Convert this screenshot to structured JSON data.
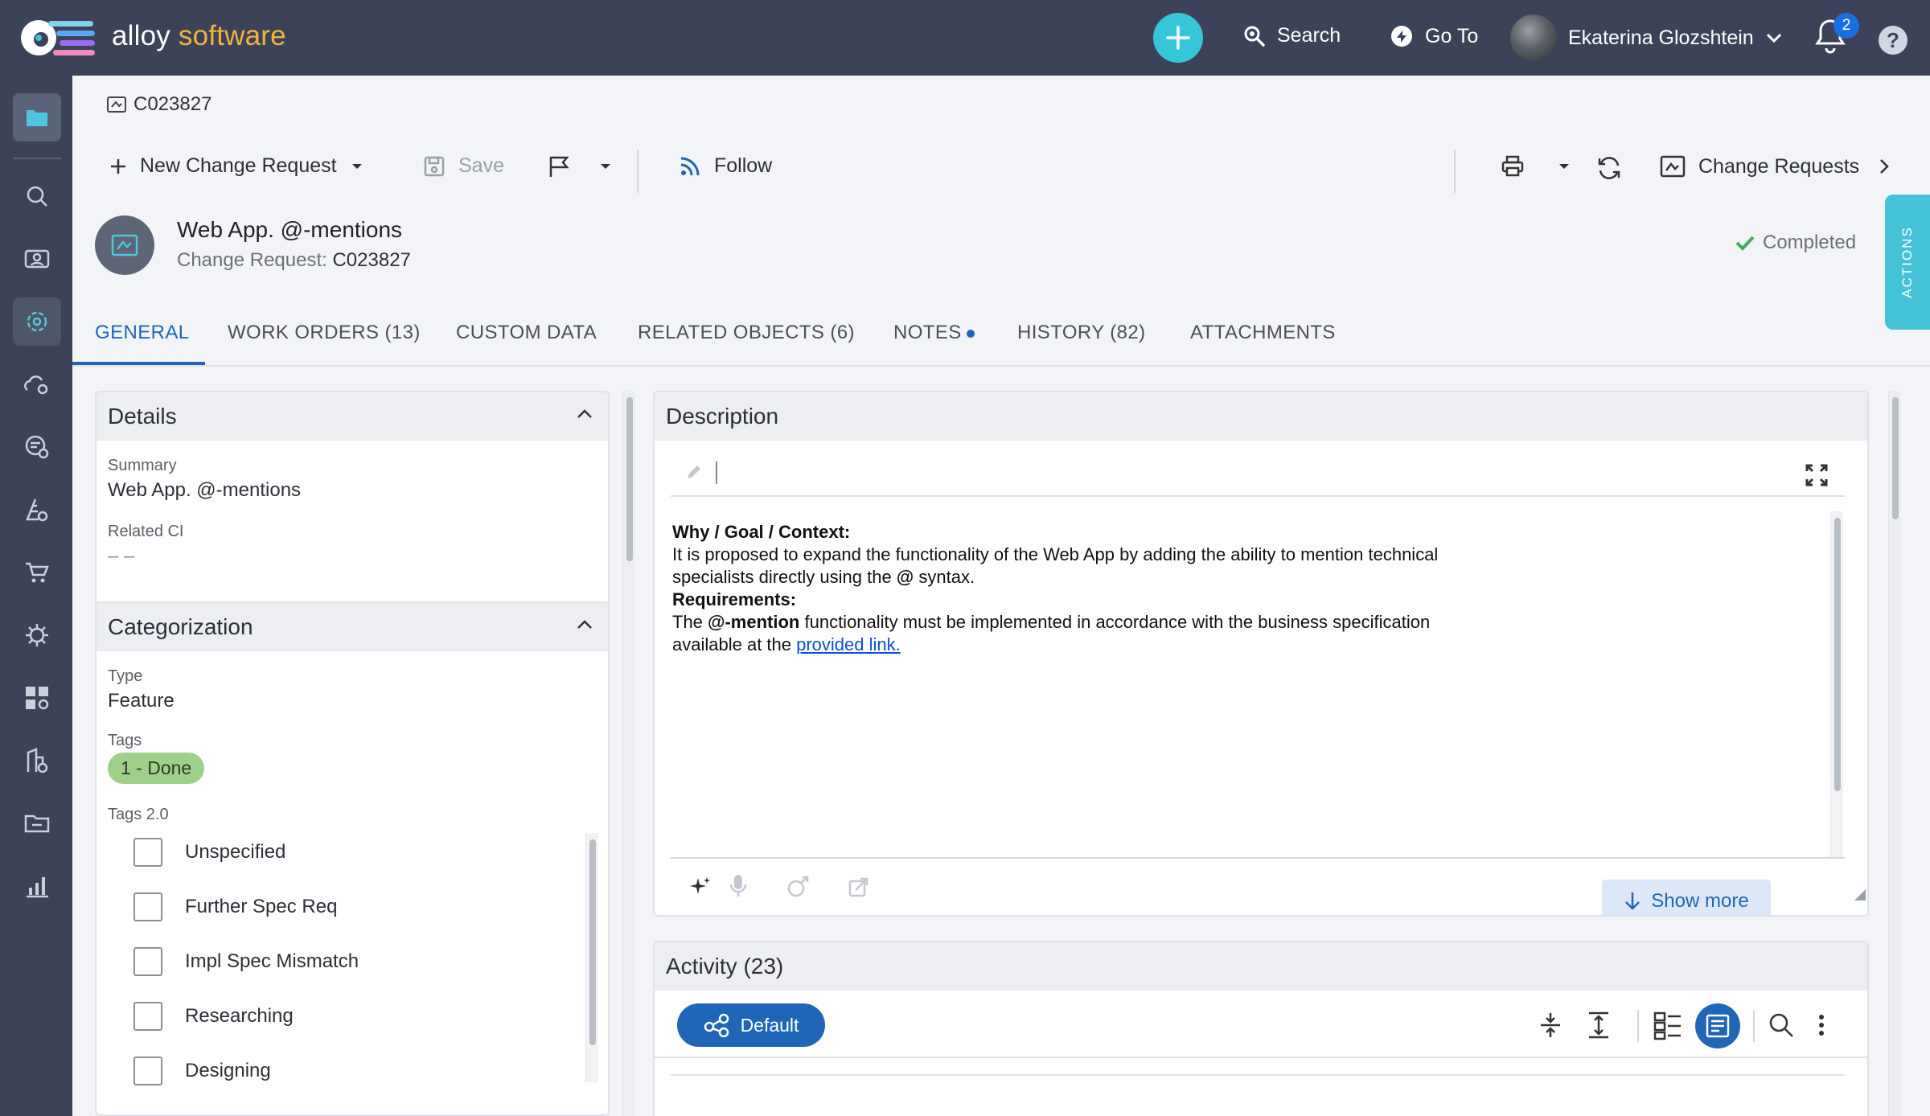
{
  "app": {
    "brand_part1": "alloy",
    "brand_part2": "software",
    "colors": {
      "bar": "#3c4358",
      "accent": "#35c6d8",
      "link": "#1f66b8",
      "tag_done": "#9fd08a"
    }
  },
  "topbar": {
    "search_label": "Search",
    "goto_label": "Go To",
    "user_name": "Ekaterina Glozshtein",
    "notification_count": "2",
    "help_label": "?"
  },
  "breadcrumb": {
    "id": "C023827"
  },
  "toolbar": {
    "new_label": "New Change Request",
    "save_label": "Save",
    "follow_label": "Follow",
    "change_requests_label": "Change Requests"
  },
  "record": {
    "title": "Web App. @-mentions",
    "subtitle_label": "Change Request:",
    "subtitle_value": "C023827",
    "status": "Completed",
    "actions_label": "ACTIONS"
  },
  "tabs": [
    {
      "label": "GENERAL"
    },
    {
      "label": "WORK ORDERS (13)"
    },
    {
      "label": "CUSTOM DATA"
    },
    {
      "label": "RELATED OBJECTS (6)"
    },
    {
      "label": "NOTES"
    },
    {
      "label": "HISTORY (82)"
    },
    {
      "label": "ATTACHMENTS"
    }
  ],
  "details": {
    "title": "Details",
    "summary_label": "Summary",
    "summary_value": "Web App. @-mentions",
    "related_ci_label": "Related CI",
    "related_ci_value": "– –"
  },
  "categorization": {
    "title": "Categorization",
    "type_label": "Type",
    "type_value": "Feature",
    "tags_label": "Tags",
    "tag_value": "1 - Done",
    "tags2_label": "Tags 2.0",
    "tags2_options": [
      "Unspecified",
      "Further Spec Req",
      "Impl Spec Mismatch",
      "Researching",
      "Designing"
    ]
  },
  "description": {
    "title": "Description",
    "heading1": "Why / Goal / Context:",
    "line1": "It is proposed to expand the functionality of the Web App by adding the ability to mention technical",
    "line2_pre": "specialists directly using the ",
    "line2_bold": "@",
    "line2_post": " syntax.",
    "heading2": "Requirements:",
    "line3_pre": "The ",
    "line3_bold": "@-mention",
    "line3_post": " functionality must be implemented in accordance with the business specification",
    "line4_pre": "available at the ",
    "line4_link": "provided link.",
    "show_more_label": "Show more"
  },
  "activity": {
    "title": "Activity (23)",
    "default_label": "Default"
  }
}
